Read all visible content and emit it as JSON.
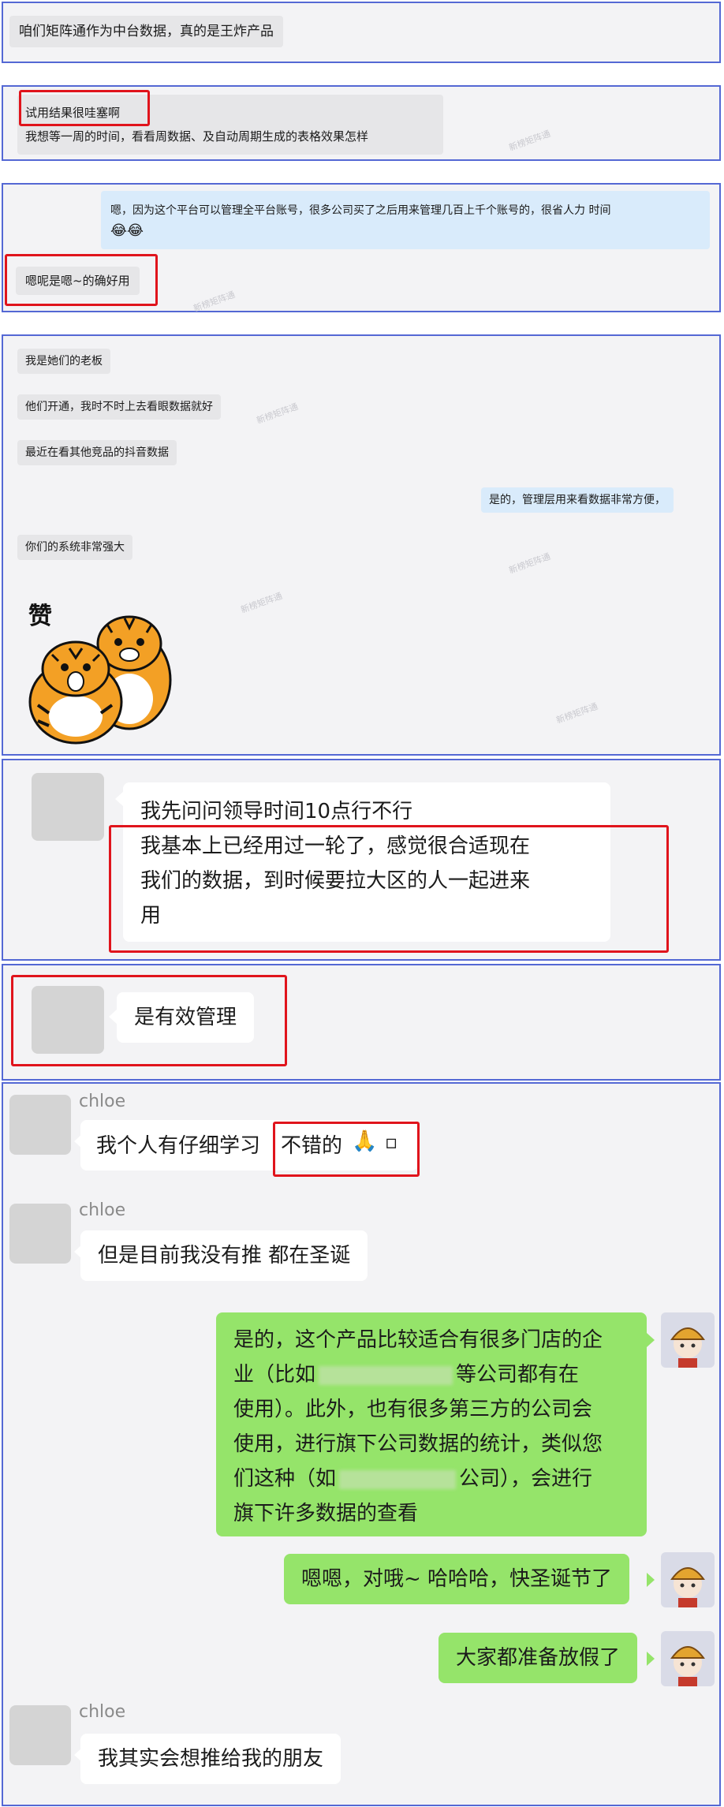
{
  "panel1": {
    "message": "咱们矩阵通作为中台数据，真的是王炸产品"
  },
  "panel2": {
    "line1": "试用结果很哇塞啊",
    "line2": "我想等一周的时间，看看周数据、及自动周期生成的表格效果怎样"
  },
  "panel3": {
    "reply_line1": "嗯，因为这个平台可以管理全平台账号，很多公司买了之后用来管理几百上千个账号的，很省人力 时间",
    "reply_emoji": "😂😂",
    "message": "嗯呢是嗯~的确好用"
  },
  "panel4": {
    "msg1": "我是她们的老板",
    "msg2": "他们开通，我时不时上去看眼数据就好",
    "msg3": "最近在看其他竞品的抖音数据",
    "reply": "是的，管理层用来看数据非常方便，",
    "msg4": "你们的系统非常强大",
    "sticker_text": "赞"
  },
  "panel5": {
    "line1": "我先问问领导时间10点行不行",
    "line2": "我基本上已经用过一轮了，感觉很合适现在",
    "line3": "我们的数据，到时候要拉大区的人一起进来",
    "line4": "用"
  },
  "panel6": {
    "message": "是有效管理"
  },
  "panel7": {
    "sender_name": "chloe",
    "msg1_part1": "我个人有仔细学习",
    "msg1_part2": "不错的",
    "msg1_emoji": "🙏",
    "msg1_tail": "▫",
    "msg2": "但是目前我没有推 都在圣诞",
    "reply1_l1": "是的，这个产品比较适合有很多门店的企",
    "reply1_l2a": "业（比如",
    "reply1_l2b": "等公司都有在",
    "reply1_l3": "使用）。此外，也有很多第三方的公司会",
    "reply1_l4": "使用，进行旗下公司数据的统计，类似您",
    "reply1_l5a": "们这种（如",
    "reply1_l5b": "公司），会进行",
    "reply1_l6": "旗下许多数据的查看",
    "reply2": "嗯嗯，对哦~ 哈哈哈，快圣诞节了",
    "reply3": "大家都准备放假了",
    "msg3": "我其实会想推给我的朋友"
  },
  "watermark": "新榜矩阵通",
  "colors": {
    "panel_border": "#5468d4",
    "highlight": "#e0141c",
    "green_bubble": "#95e46a",
    "blue_bubble": "#d9ebfb"
  }
}
